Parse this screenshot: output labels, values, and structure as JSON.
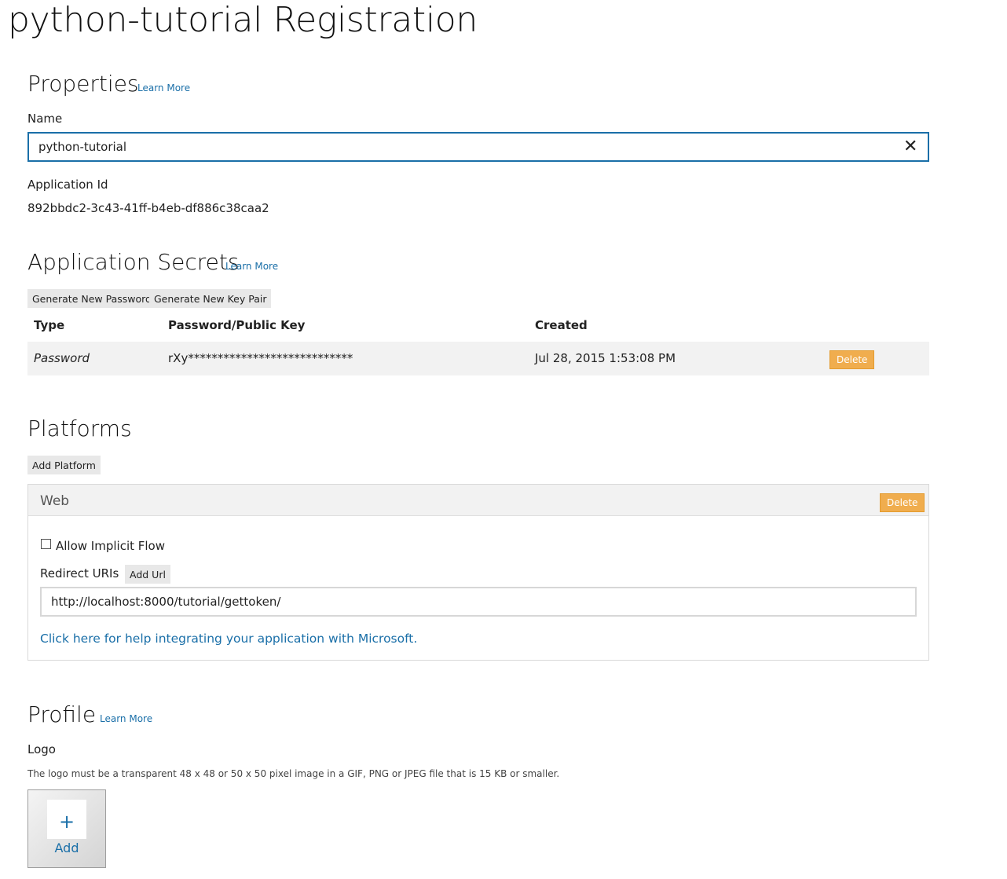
{
  "page": {
    "title": "python-tutorial Registration"
  },
  "properties": {
    "title": "Properties",
    "learn_more": "Learn More",
    "name_label": "Name",
    "name_value": "python-tutorial",
    "app_id_label": "Application Id",
    "app_id_value": "892bbdc2-3c43-41ff-b4eb-df886c38caa2"
  },
  "secrets": {
    "title": "Application Secrets",
    "learn_more": "Learn More",
    "generate_password": "Generate New Password",
    "generate_key_pair": "Generate New Key Pair",
    "columns": {
      "type": "Type",
      "key": "Password/Public Key",
      "created": "Created"
    },
    "rows": [
      {
        "type": "Password",
        "key": "rXy****************************",
        "created": "Jul 28, 2015 1:53:08 PM",
        "delete": "Delete"
      }
    ]
  },
  "platforms": {
    "title": "Platforms",
    "add_platform": "Add Platform",
    "web": {
      "title": "Web",
      "delete": "Delete",
      "allow_implicit_flow": "Allow Implicit Flow",
      "allow_implicit_flow_checked": false,
      "redirect_label": "Redirect URIs",
      "add_url": "Add Url",
      "redirect_uri": "http://localhost:8000/tutorial/gettoken/",
      "help_link": "Click here for help integrating your application with Microsoft."
    }
  },
  "profile": {
    "title": "Profile",
    "learn_more": "Learn More",
    "logo_label": "Logo",
    "logo_help": "The logo must be a transparent 48 x 48 or 50 x 50 pixel image in a GIF, PNG or JPEG file that is 15 KB or smaller.",
    "add_symbol": "+",
    "add_label": "Add"
  },
  "colors": {
    "accent": "#1a6fa8",
    "delete": "#f0ad4e",
    "row_bg": "#f2f2f2"
  }
}
